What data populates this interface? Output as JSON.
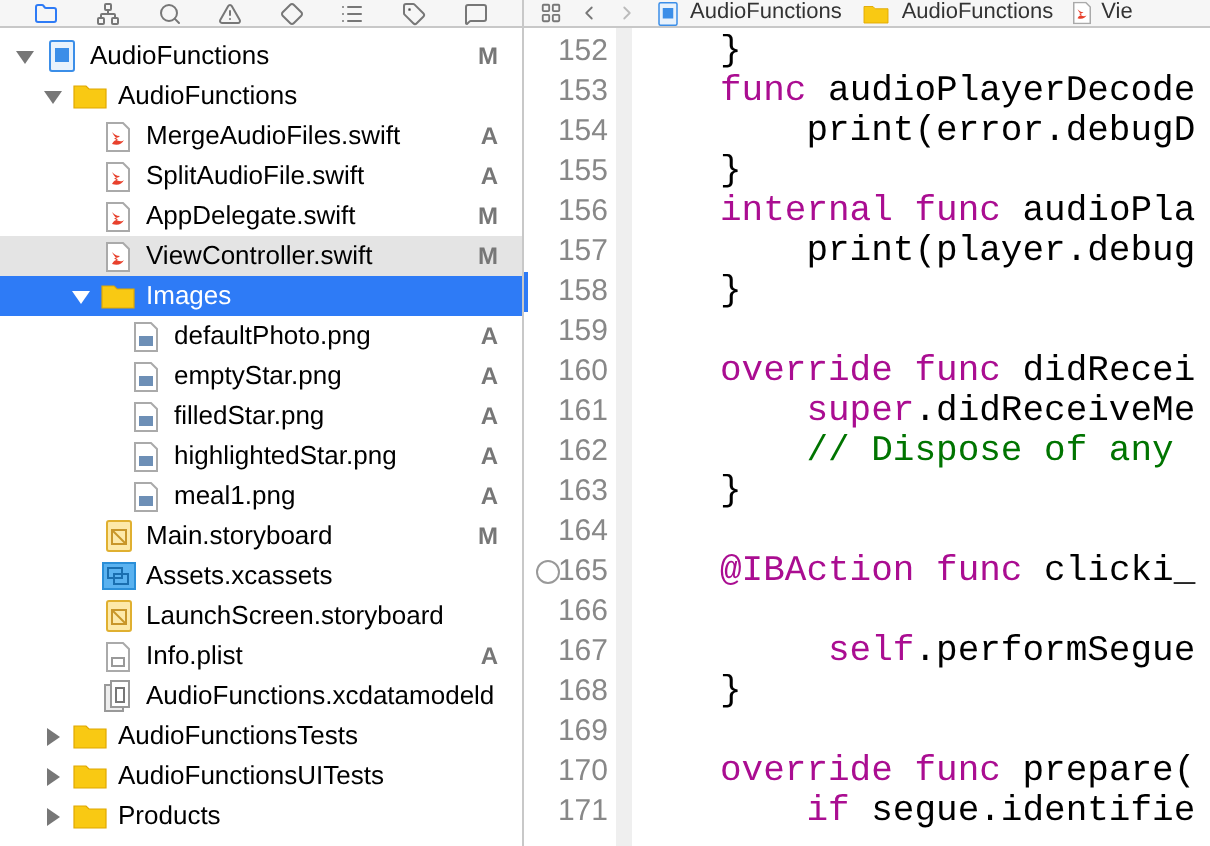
{
  "navigator_tabs": [
    {
      "kind": "folder",
      "selected": true
    },
    {
      "kind": "hierarchy",
      "selected": false
    },
    {
      "kind": "search",
      "selected": false
    },
    {
      "kind": "warning",
      "selected": false
    },
    {
      "kind": "diamond",
      "selected": false
    },
    {
      "kind": "list",
      "selected": false
    },
    {
      "kind": "tag",
      "selected": false
    },
    {
      "kind": "chat",
      "selected": false
    }
  ],
  "tree": [
    {
      "name": "AudioFunctions",
      "kind": "project",
      "badge": "M",
      "expanded": true,
      "selected": false,
      "highlighted": false,
      "children": [
        {
          "name": "AudioFunctions",
          "kind": "folder",
          "expanded": true,
          "selected": false,
          "highlighted": false,
          "children": [
            {
              "name": "MergeAudioFiles.swift",
              "kind": "swift",
              "badge": "A",
              "selected": false,
              "highlighted": false
            },
            {
              "name": "SplitAudioFile.swift",
              "kind": "swift",
              "badge": "A",
              "selected": false,
              "highlighted": false
            },
            {
              "name": "AppDelegate.swift",
              "kind": "swift",
              "badge": "M",
              "selected": false,
              "highlighted": false
            },
            {
              "name": "ViewController.swift",
              "kind": "swift",
              "badge": "M",
              "selected": false,
              "highlighted": true
            },
            {
              "name": "Images",
              "kind": "folder",
              "expanded": true,
              "selected": true,
              "highlighted": false,
              "children": [
                {
                  "name": "defaultPhoto.png",
                  "kind": "image",
                  "badge": "A",
                  "selected": false,
                  "highlighted": false
                },
                {
                  "name": "emptyStar.png",
                  "kind": "image",
                  "badge": "A",
                  "selected": false,
                  "highlighted": false
                },
                {
                  "name": "filledStar.png",
                  "kind": "image",
                  "badge": "A",
                  "selected": false,
                  "highlighted": false
                },
                {
                  "name": "highlightedStar.png",
                  "kind": "image",
                  "badge": "A",
                  "selected": false,
                  "highlighted": false
                },
                {
                  "name": "meal1.png",
                  "kind": "image",
                  "badge": "A",
                  "selected": false,
                  "highlighted": false
                }
              ]
            },
            {
              "name": "Main.storyboard",
              "kind": "storyboard",
              "badge": "M",
              "selected": false,
              "highlighted": false
            },
            {
              "name": "Assets.xcassets",
              "kind": "assets",
              "selected": false,
              "highlighted": false
            },
            {
              "name": "LaunchScreen.storyboard",
              "kind": "storyboard",
              "selected": false,
              "highlighted": false
            },
            {
              "name": "Info.plist",
              "kind": "plist",
              "badge": "A",
              "selected": false,
              "highlighted": false
            },
            {
              "name": "AudioFunctions.xcdatamodeld",
              "kind": "datamodel",
              "selected": false,
              "highlighted": false
            }
          ]
        },
        {
          "name": "AudioFunctionsTests",
          "kind": "folder",
          "expanded": false,
          "selected": false,
          "highlighted": false
        },
        {
          "name": "AudioFunctionsUITests",
          "kind": "folder",
          "expanded": false,
          "selected": false,
          "highlighted": false
        },
        {
          "name": "Products",
          "kind": "folder",
          "expanded": false,
          "selected": false,
          "highlighted": false
        }
      ]
    }
  ],
  "breadcrumb": [
    {
      "kind": "project",
      "label": "AudioFunctions"
    },
    {
      "kind": "folder",
      "label": "AudioFunctions"
    },
    {
      "kind": "swift",
      "label": "Vie"
    }
  ],
  "code_lines": [
    {
      "number": "152",
      "current": false,
      "breakpoint": false,
      "tokens": [
        {
          "kind": "plain",
          "text": "}"
        }
      ]
    },
    {
      "number": "153",
      "current": false,
      "breakpoint": false,
      "tokens": [
        {
          "kind": "keyword",
          "text": "func"
        },
        {
          "kind": "plain",
          "text": " audioPlayerDecode"
        }
      ]
    },
    {
      "number": "154",
      "current": false,
      "breakpoint": false,
      "tokens": [
        {
          "kind": "plain",
          "text": "    print(error.debugD"
        }
      ]
    },
    {
      "number": "155",
      "current": false,
      "breakpoint": false,
      "tokens": [
        {
          "kind": "plain",
          "text": "}"
        }
      ]
    },
    {
      "number": "156",
      "current": false,
      "breakpoint": false,
      "tokens": [
        {
          "kind": "keyword",
          "text": "internal func"
        },
        {
          "kind": "plain",
          "text": " audioPla"
        }
      ]
    },
    {
      "number": "157",
      "current": false,
      "breakpoint": false,
      "tokens": [
        {
          "kind": "plain",
          "text": "    print(player.debug"
        }
      ]
    },
    {
      "number": "158",
      "current": true,
      "breakpoint": false,
      "tokens": [
        {
          "kind": "plain",
          "text": "}"
        }
      ]
    },
    {
      "number": "159",
      "current": false,
      "breakpoint": false
    },
    {
      "number": "160",
      "current": false,
      "breakpoint": false,
      "tokens": [
        {
          "kind": "keyword",
          "text": "override func"
        },
        {
          "kind": "plain",
          "text": " didRecei"
        }
      ]
    },
    {
      "number": "161",
      "current": false,
      "breakpoint": false,
      "tokens": [
        {
          "kind": "keyword",
          "text": "    super"
        },
        {
          "kind": "plain",
          "text": ".didReceiveMe"
        }
      ]
    },
    {
      "number": "162",
      "current": false,
      "breakpoint": false,
      "tokens": [
        {
          "kind": "comment",
          "text": "    // Dispose of any"
        }
      ]
    },
    {
      "number": "163",
      "current": false,
      "breakpoint": false,
      "tokens": [
        {
          "kind": "plain",
          "text": "}"
        }
      ]
    },
    {
      "number": "164",
      "current": false,
      "breakpoint": false
    },
    {
      "number": "165",
      "current": false,
      "breakpoint": true,
      "tokens": [
        {
          "kind": "keyword",
          "text": "@IBAction func"
        },
        {
          "kind": "plain",
          "text": " clicki_"
        }
      ]
    },
    {
      "number": "166",
      "current": false,
      "breakpoint": false
    },
    {
      "number": "167",
      "current": false,
      "breakpoint": false,
      "tokens": [
        {
          "kind": "keyword",
          "text": "     self"
        },
        {
          "kind": "plain",
          "text": ".performSegue"
        }
      ]
    },
    {
      "number": "168",
      "current": false,
      "breakpoint": false,
      "tokens": [
        {
          "kind": "plain",
          "text": "}"
        }
      ]
    },
    {
      "number": "169",
      "current": false,
      "breakpoint": false
    },
    {
      "number": "170",
      "current": false,
      "breakpoint": false,
      "tokens": [
        {
          "kind": "keyword",
          "text": "override func"
        },
        {
          "kind": "plain",
          "text": " prepare("
        }
      ]
    },
    {
      "number": "171",
      "current": false,
      "breakpoint": false,
      "tokens": [
        {
          "kind": "keyword",
          "text": "    if"
        },
        {
          "kind": "plain",
          "text": " segue.identifie"
        }
      ]
    }
  ]
}
